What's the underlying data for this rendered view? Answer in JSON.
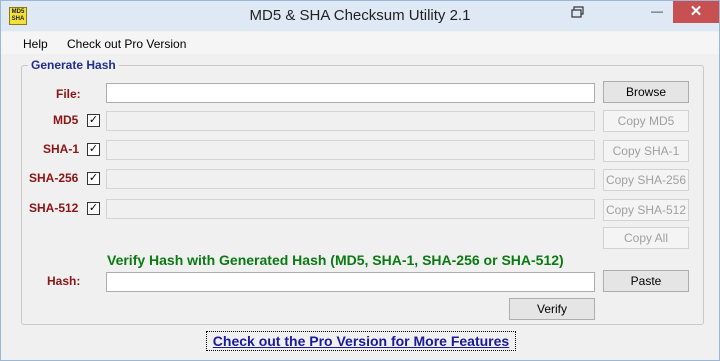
{
  "app": {
    "icon_text": "MD5 SHA",
    "title": "MD5 & SHA Checksum Utility 2.1",
    "minimize_label": "—",
    "close_label": "✕",
    "restore_icon": "restore-window-icon"
  },
  "menu": {
    "help": "Help",
    "pro": "Check out Pro Version"
  },
  "group": {
    "label": "Generate Hash"
  },
  "file": {
    "label": "File:",
    "value": "",
    "browse": "Browse"
  },
  "hashes": {
    "md5": {
      "label": "MD5",
      "checked": "✓",
      "value": "",
      "copy": "Copy MD5"
    },
    "sha1": {
      "label": "SHA-1",
      "checked": "✓",
      "value": "",
      "copy": "Copy SHA-1"
    },
    "sha256": {
      "label": "SHA-256",
      "checked": "✓",
      "value": "",
      "copy": "Copy SHA-256"
    },
    "sha512": {
      "label": "SHA-512",
      "checked": "✓",
      "value": "",
      "copy": "Copy SHA-512"
    }
  },
  "copy_all": "Copy All",
  "verify": {
    "title": "Verify Hash with Generated Hash (MD5, SHA-1, SHA-256 or SHA-512)",
    "hash_label": "Hash:",
    "hash_value": "",
    "paste": "Paste",
    "verify_button": "Verify"
  },
  "footer": {
    "link": "Check out the Pro Version for More Features"
  }
}
